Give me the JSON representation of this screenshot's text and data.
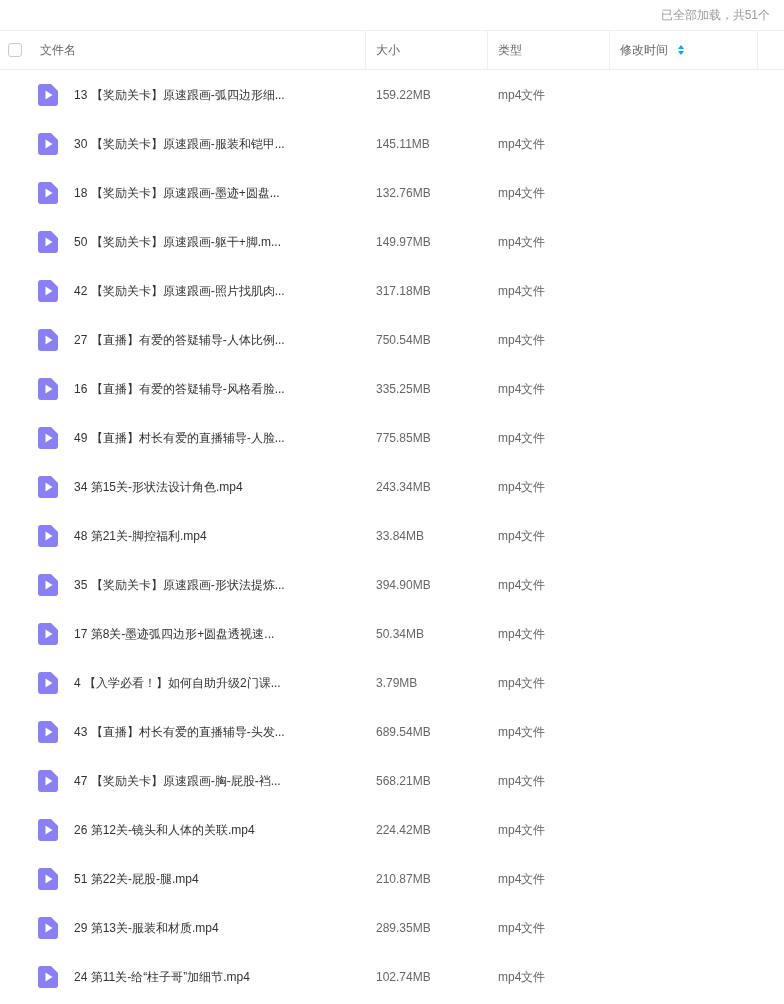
{
  "status": "已全部加载，共51个",
  "header": {
    "checked": false,
    "columns": [
      "文件名",
      "大小",
      "类型",
      "修改时间"
    ]
  },
  "rows": [
    {
      "name": "13 【奖励关卡】原速跟画-弧四边形细...",
      "size": "159.22MB",
      "type": "mp4文件"
    },
    {
      "name": "30 【奖励关卡】原速跟画-服装和铠甲...",
      "size": "145.11MB",
      "type": "mp4文件"
    },
    {
      "name": "18 【奖励关卡】原速跟画-墨迹+圆盘...",
      "size": "132.76MB",
      "type": "mp4文件"
    },
    {
      "name": "50 【奖励关卡】原速跟画-躯干+脚.m...",
      "size": "149.97MB",
      "type": "mp4文件"
    },
    {
      "name": "42 【奖励关卡】原速跟画-照片找肌肉...",
      "size": "317.18MB",
      "type": "mp4文件"
    },
    {
      "name": "27 【直播】有爱的答疑辅导-人体比例...",
      "size": "750.54MB",
      "type": "mp4文件"
    },
    {
      "name": "16 【直播】有爱的答疑辅导-风格看脸...",
      "size": "335.25MB",
      "type": "mp4文件"
    },
    {
      "name": "49 【直播】村长有爱的直播辅导-人脸...",
      "size": "775.85MB",
      "type": "mp4文件"
    },
    {
      "name": "34 第15关-形状法设计角色.mp4",
      "size": "243.34MB",
      "type": "mp4文件"
    },
    {
      "name": "48 第21关-脚控福利.mp4",
      "size": "33.84MB",
      "type": "mp4文件"
    },
    {
      "name": "35 【奖励关卡】原速跟画-形状法提炼...",
      "size": "394.90MB",
      "type": "mp4文件"
    },
    {
      "name": "17 第8关-墨迹弧四边形+圆盘透视速...",
      "size": "50.34MB",
      "type": "mp4文件"
    },
    {
      "name": "4 【入学必看！】如何自助升级2门课...",
      "size": "3.79MB",
      "type": "mp4文件"
    },
    {
      "name": "43 【直播】村长有爱的直播辅导-头发...",
      "size": "689.54MB",
      "type": "mp4文件"
    },
    {
      "name": "47 【奖励关卡】原速跟画-胸-屁股-裆...",
      "size": "568.21MB",
      "type": "mp4文件"
    },
    {
      "name": "26 第12关-镜头和人体的关联.mp4",
      "size": "224.42MB",
      "type": "mp4文件"
    },
    {
      "name": "51 第22关-屁股-腿.mp4",
      "size": "210.87MB",
      "type": "mp4文件"
    },
    {
      "name": "29 第13关-服装和材质.mp4",
      "size": "289.35MB",
      "type": "mp4文件"
    },
    {
      "name": "24 第11关-给“柱子哥”加细节.mp4",
      "size": "102.74MB",
      "type": "mp4文件"
    }
  ]
}
